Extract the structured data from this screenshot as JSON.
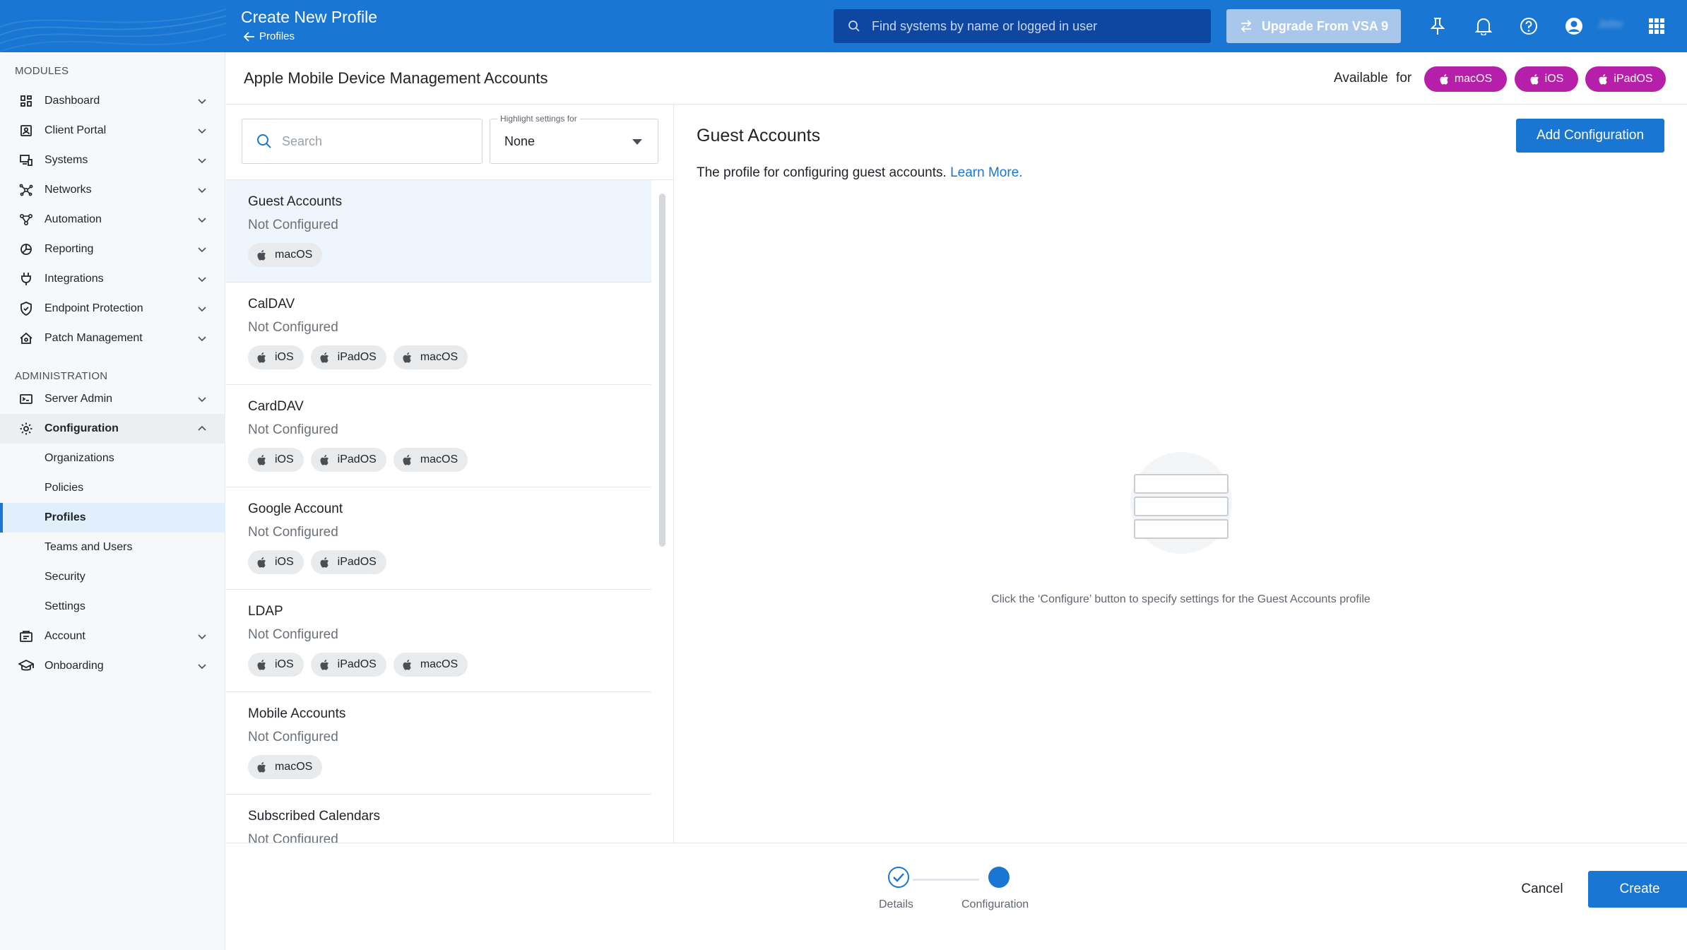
{
  "header": {
    "title": "Create New Profile",
    "breadcrumb": "Profiles",
    "search_placeholder": "Find systems by name or logged in user",
    "upgrade_label": "Upgrade From VSA 9",
    "user_name": "John"
  },
  "sidebar": {
    "modules_label": "MODULES",
    "admin_label": "ADMINISTRATION",
    "modules": [
      {
        "label": "Dashboard",
        "icon": "dashboard-icon"
      },
      {
        "label": "Client Portal",
        "icon": "portal-icon"
      },
      {
        "label": "Systems",
        "icon": "devices-icon"
      },
      {
        "label": "Networks",
        "icon": "network-icon"
      },
      {
        "label": "Automation",
        "icon": "automation-icon"
      },
      {
        "label": "Reporting",
        "icon": "reporting-icon"
      },
      {
        "label": "Integrations",
        "icon": "plug-icon"
      },
      {
        "label": "Endpoint Protection",
        "icon": "shield-icon"
      },
      {
        "label": "Patch Management",
        "icon": "patch-icon"
      }
    ],
    "admin": [
      {
        "label": "Server Admin",
        "icon": "server-icon"
      },
      {
        "label": "Configuration",
        "icon": "gear-icon"
      },
      {
        "label": "Account",
        "icon": "account-icon"
      },
      {
        "label": "Onboarding",
        "icon": "graduation-icon"
      }
    ],
    "configuration_children": [
      "Organizations",
      "Policies",
      "Profiles",
      "Teams and Users",
      "Security",
      "Settings"
    ],
    "active_child": "Profiles"
  },
  "page": {
    "title": "Apple Mobile Device Management Accounts",
    "available_label": "Available for",
    "available_os": [
      "macOS",
      "iOS",
      "iPadOS"
    ],
    "pill_color": "#b51fa9"
  },
  "list": {
    "search_placeholder": "Search",
    "highlight_label": "Highlight settings for",
    "highlight_value": "None",
    "items": [
      {
        "name": "Guest Accounts",
        "status": "Not Configured",
        "tags": [
          "macOS"
        ]
      },
      {
        "name": "CalDAV",
        "status": "Not Configured",
        "tags": [
          "iOS",
          "iPadOS",
          "macOS"
        ]
      },
      {
        "name": "CardDAV",
        "status": "Not Configured",
        "tags": [
          "iOS",
          "iPadOS",
          "macOS"
        ]
      },
      {
        "name": "Google Account",
        "status": "Not Configured",
        "tags": [
          "iOS",
          "iPadOS"
        ]
      },
      {
        "name": "LDAP",
        "status": "Not Configured",
        "tags": [
          "iOS",
          "iPadOS",
          "macOS"
        ]
      },
      {
        "name": "Mobile Accounts",
        "status": "Not Configured",
        "tags": [
          "macOS"
        ]
      },
      {
        "name": "Subscribed Calendars",
        "status": "Not Configured",
        "tags": []
      }
    ]
  },
  "detail": {
    "title": "Guest Accounts",
    "description": "The profile for configuring guest accounts.",
    "learn_more": "Learn More.",
    "add_button": "Add Configuration",
    "empty_text": "Click the ‘Configure’ button to specify settings for the Guest Accounts profile"
  },
  "footer": {
    "steps": [
      "Details",
      "Configuration"
    ],
    "cancel_label": "Cancel",
    "create_label": "Create"
  },
  "colors": {
    "primary": "#1976d2",
    "accent": "#b51fa9"
  }
}
